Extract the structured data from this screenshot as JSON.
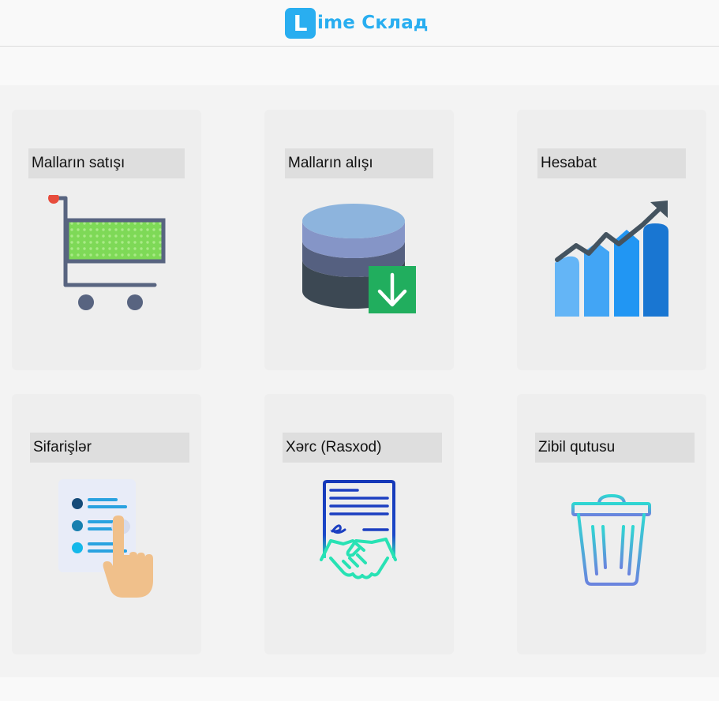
{
  "header": {
    "logo_letter": "L",
    "logo_text": "ime Склад"
  },
  "cards": [
    {
      "label": "Malların satışı",
      "icon": "shopping-cart-icon"
    },
    {
      "label": "Malların alışı",
      "icon": "database-download-icon"
    },
    {
      "label": "Hesabat",
      "icon": "growth-chart-icon"
    },
    {
      "label": "Sifarişlər",
      "icon": "order-list-icon"
    },
    {
      "label": "Xərc (Rasxod)",
      "icon": "contract-handshake-icon"
    },
    {
      "label": "Zibil qutusu",
      "icon": "trash-bin-icon"
    }
  ],
  "colors": {
    "brand": "#29aef0",
    "card_bg": "#eeeeee",
    "label_bg": "#dedede",
    "panel_bg": "#f3f3f3"
  }
}
